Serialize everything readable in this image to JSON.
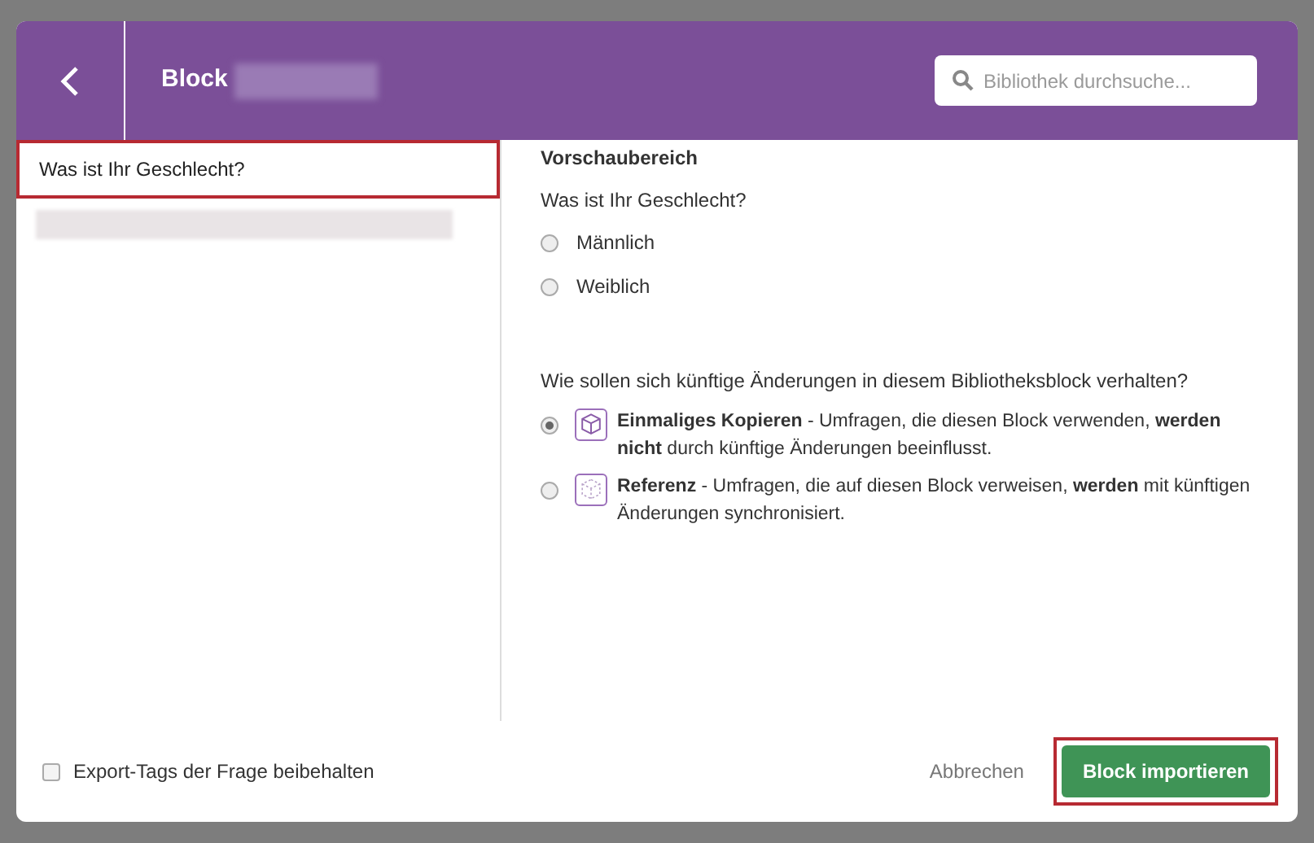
{
  "dialog": {
    "title": "Block",
    "title_redacted": true,
    "search": {
      "placeholder": "Bibliothek durchsuche..."
    }
  },
  "questions": [
    {
      "kind": "text",
      "label": "Was ist Ihr Geschlecht?",
      "selected": true
    },
    {
      "kind": "redacted",
      "selected": false
    }
  ],
  "preview": {
    "heading": "Vorschaubereich",
    "question": "Was ist Ihr Geschlecht?",
    "options": [
      {
        "label": "Männlich",
        "selected": false
      },
      {
        "label": "Weiblich",
        "selected": false
      }
    ]
  },
  "behavior": {
    "prompt": "Wie sollen sich künftige Änderungen in diesem Bibliotheksblock verhalten?",
    "options": [
      {
        "kind": "copy",
        "text": "**Einmaliges Kopieren** - Umfragen, die diesen Block verwenden, **werden nicht** durch künftige Änderungen beeinflusst.",
        "selected": true
      },
      {
        "kind": "reference",
        "text": "**Referenz** - Umfragen, die auf diesen Block verweisen, **werden** mit künftigen Änderungen synchronisiert.",
        "selected": false
      }
    ]
  },
  "footer": {
    "checkbox": {
      "label": "Export-Tags der Frage beibehalten",
      "checked": false
    },
    "cancel": "Abbrechen",
    "import": {
      "label": "Block importieren",
      "highlighted": true
    }
  }
}
